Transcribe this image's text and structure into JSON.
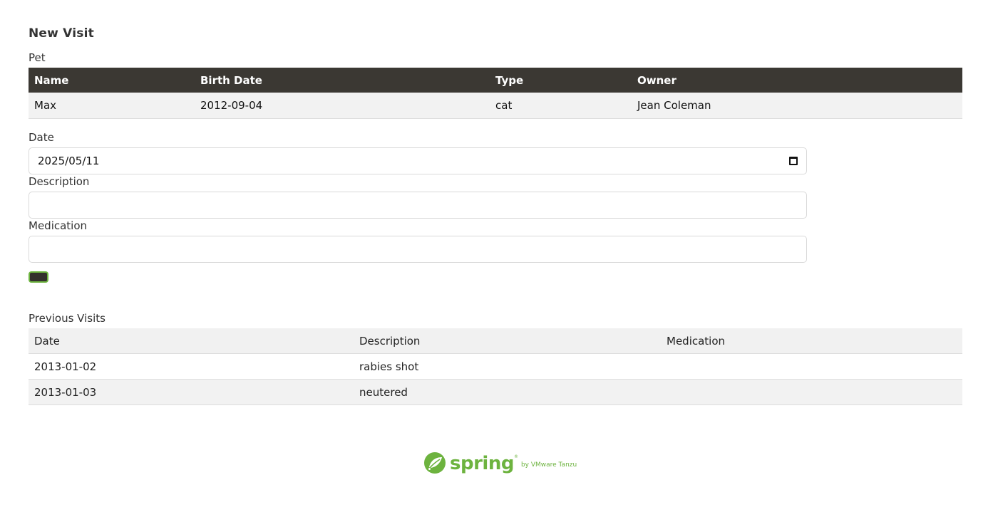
{
  "page": {
    "title": "New Visit"
  },
  "pet_section": {
    "label": "Pet",
    "headers": [
      "Name",
      "Birth Date",
      "Type",
      "Owner"
    ],
    "row": [
      "Max",
      "2012-09-04",
      "cat",
      "Jean Coleman"
    ]
  },
  "form": {
    "date_label": "Date",
    "date_value": "2025/05/11",
    "description_label": "Description",
    "description_value": "",
    "medication_label": "Medication",
    "medication_value": "",
    "submit_label": ""
  },
  "visits_section": {
    "label": "Previous Visits",
    "headers": [
      "Date",
      "Description",
      "Medication"
    ],
    "rows": [
      [
        "2013-01-02",
        "rabies shot",
        ""
      ],
      [
        "2013-01-03",
        "neutered",
        ""
      ]
    ]
  },
  "footer": {
    "brand": "spring",
    "reg_mark": "®",
    "byline": "by VMware Tanzu",
    "brand_color": "#6db33f"
  },
  "colors": {
    "table_header_bg": "#3b3833",
    "button_border": "#6db33f",
    "button_bg": "#34302d"
  }
}
